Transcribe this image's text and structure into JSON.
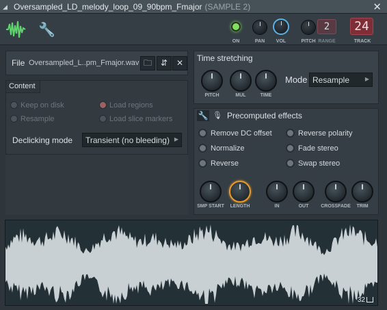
{
  "window": {
    "title": "Oversampled_LD_melody_loop_09_90bpm_Fmajor",
    "subtitle": "(SAMPLE 2)",
    "close_glyph": "✕"
  },
  "toolbar": {
    "on_label": "ON",
    "pan_label": "PAN",
    "vol_label": "VOL",
    "pitch_label": "PITCH",
    "range_label": "RANGE",
    "range_value": "2",
    "track_label": "TRACK",
    "track_value": "24",
    "on_led_color": "#7fe05d",
    "vol_ring_color": "#5cb2e6"
  },
  "file": {
    "label": "File",
    "name": "Oversampled_L..pm_Fmajor.wav"
  },
  "content": {
    "title": "Content",
    "options": [
      {
        "label": "Keep on disk",
        "checked": false
      },
      {
        "label": "Load regions",
        "checked": true
      },
      {
        "label": "Resample",
        "checked": false
      },
      {
        "label": "Load slice markers",
        "checked": false
      }
    ],
    "declicking_label": "Declicking mode",
    "declicking_value": "Transient (no bleeding)"
  },
  "time_stretching": {
    "title": "Time stretching",
    "knobs": [
      "PITCH",
      "MUL",
      "TIME"
    ],
    "mode_label": "Mode",
    "mode_value": "Resample"
  },
  "precomputed": {
    "title": "Precomputed effects",
    "effects": [
      {
        "label": "Remove DC offset",
        "checked": false
      },
      {
        "label": "Reverse polarity",
        "checked": false
      },
      {
        "label": "Normalize",
        "checked": false
      },
      {
        "label": "Fade stereo",
        "checked": false
      },
      {
        "label": "Reverse",
        "checked": false
      },
      {
        "label": "Swap stereo",
        "checked": false
      }
    ],
    "knobs": [
      "SMP START",
      "LENGTH",
      "IN",
      "OUT",
      "CROSSFADE",
      "TRIM"
    ],
    "accent_color": "#e99a2c"
  },
  "waveform": {
    "zoom_label": "32",
    "wave_color": "#c9d0d3",
    "background_color": "#233036"
  }
}
